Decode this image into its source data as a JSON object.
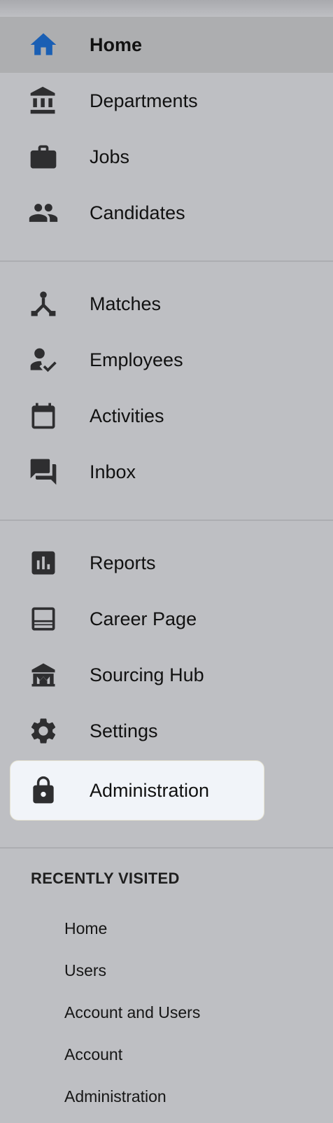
{
  "colors": {
    "background": "#bebfc3",
    "active_bg": "#adaeb0",
    "selected_bg": "#f1f4f9",
    "home_icon": "#1a5fb4",
    "icon": "#2e2e30"
  },
  "nav": {
    "group1": [
      {
        "label": "Home",
        "icon": "home-icon"
      },
      {
        "label": "Departments",
        "icon": "bank-icon"
      },
      {
        "label": "Jobs",
        "icon": "briefcase-icon"
      },
      {
        "label": "Candidates",
        "icon": "people-icon"
      }
    ],
    "group2": [
      {
        "label": "Matches",
        "icon": "merge-icon"
      },
      {
        "label": "Employees",
        "icon": "person-check-icon"
      },
      {
        "label": "Activities",
        "icon": "calendar-icon"
      },
      {
        "label": "Inbox",
        "icon": "chat-icon"
      }
    ],
    "group3": [
      {
        "label": "Reports",
        "icon": "bar-chart-icon"
      },
      {
        "label": "Career Page",
        "icon": "web-page-icon"
      },
      {
        "label": "Sourcing Hub",
        "icon": "museum-icon"
      },
      {
        "label": "Settings",
        "icon": "gear-icon"
      },
      {
        "label": "Administration",
        "icon": "lock-icon"
      }
    ]
  },
  "recent": {
    "title": "RECENTLY VISITED",
    "items": [
      "Home",
      "Users",
      "Account and Users",
      "Account",
      "Administration"
    ]
  }
}
